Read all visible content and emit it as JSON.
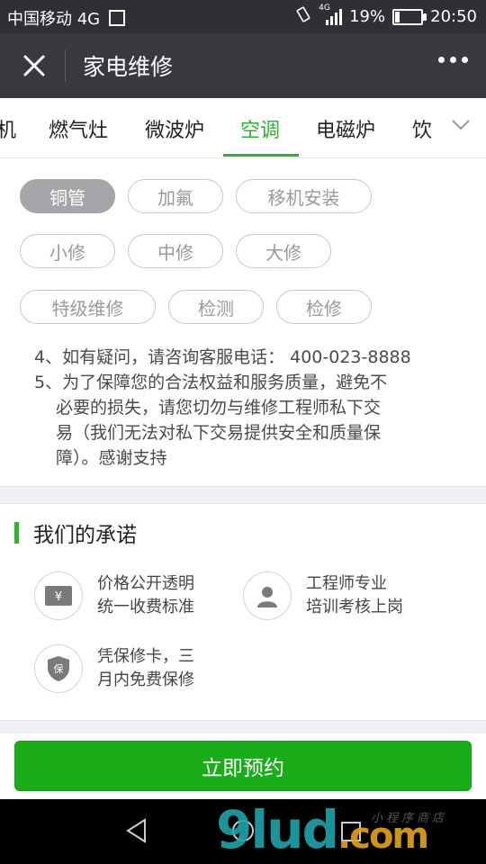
{
  "status_bar": {
    "carrier": "中国移动 4G",
    "network_badge": "4G",
    "battery_percent": "19%",
    "battery_level": 0.19,
    "time": "20:50"
  },
  "top_bar": {
    "title": "家电维修"
  },
  "tabs": [
    {
      "label": "机",
      "active": false
    },
    {
      "label": "燃气灶",
      "active": false
    },
    {
      "label": "微波炉",
      "active": false
    },
    {
      "label": "空调",
      "active": true
    },
    {
      "label": "电磁炉",
      "active": false
    },
    {
      "label": "饮",
      "active": false
    }
  ],
  "chips": [
    {
      "label": "铜管",
      "selected": true
    },
    {
      "label": "加氟",
      "selected": false
    },
    {
      "label": "移机安装",
      "selected": false
    },
    {
      "label": "小修",
      "selected": false
    },
    {
      "label": "中修",
      "selected": false
    },
    {
      "label": "大修",
      "selected": false
    },
    {
      "label": "特级维修",
      "selected": false
    },
    {
      "label": "检测",
      "selected": false
    },
    {
      "label": "检修",
      "selected": false
    }
  ],
  "notes": {
    "line1": "4、如有疑问，请咨询客服电话： 400-023-8888",
    "line2a": "5、为了保障您的合法权益和服务质量，避免不",
    "line2b": "必要的损失，请您切勿与维修工程师私下交",
    "line2c": "易（我们无法对私下交易提供安全和质量保",
    "line2d": "障）。感谢支持"
  },
  "promise": {
    "title": "我们的承诺",
    "items": [
      {
        "icon": "yen-icon",
        "line1": "价格公开透明",
        "line2": "统一收费标准"
      },
      {
        "icon": "engineer-icon",
        "line1": "工程师专业",
        "line2": "培训考核上岗"
      },
      {
        "icon": "warranty-shield-icon",
        "line1": "凭保修卡，三",
        "line2": "月内免费保修"
      }
    ]
  },
  "cta": {
    "label": "立即预约"
  },
  "watermark": {
    "text": "9lud",
    "suffix": ".com",
    "small": "小程序商店"
  },
  "colors": {
    "accent": "#2fb232",
    "cta": "#1aad19",
    "topbar": "#393a3f"
  }
}
